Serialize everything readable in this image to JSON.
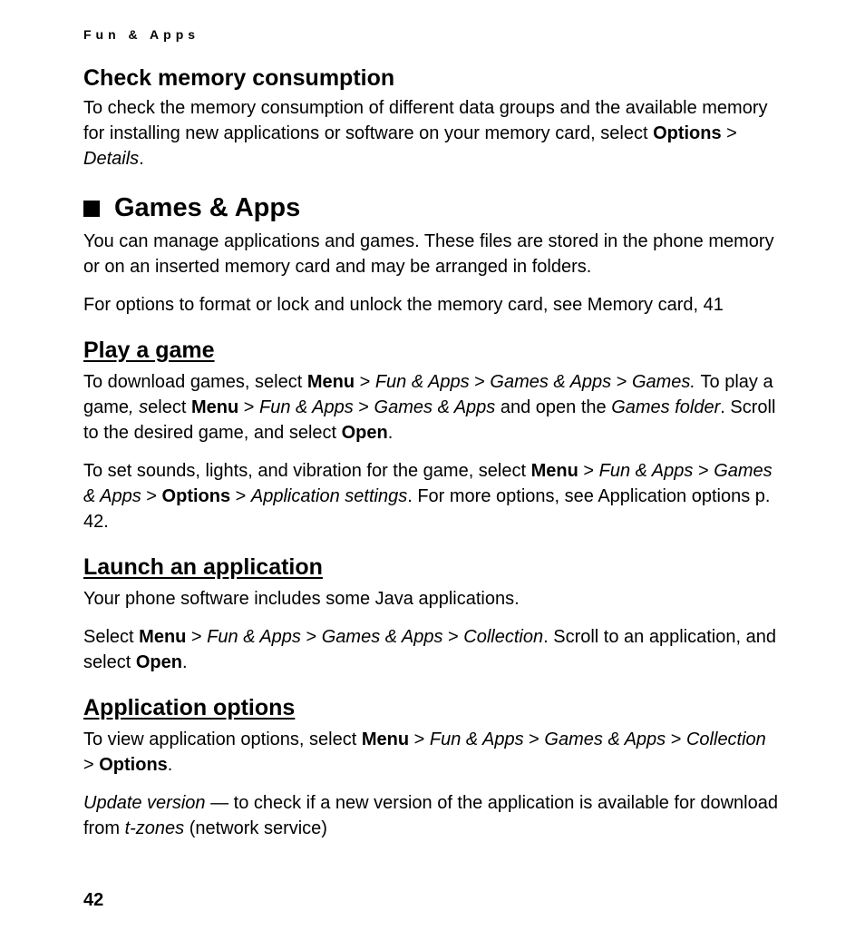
{
  "runningHeader": "Fun & Apps",
  "sections": {
    "checkMemory": {
      "title": "Check memory consumption",
      "p1_a": "To check the memory consumption of different data groups and the available memory for installing new applications or software on your memory card, select ",
      "p1_b": "Options",
      "p1_c": " > ",
      "p1_d": "Details",
      "p1_e": "."
    },
    "gamesApps": {
      "title": "Games & Apps",
      "p1": "You can manage applications and games. These files are stored in the phone memory or on an inserted memory card and may be arranged in folders.",
      "p2": "For options to format or lock and unlock the memory card, see Memory card, 41"
    },
    "playGame": {
      "title": "Play a game",
      "p1_a": "To download games, select ",
      "p1_b": "Menu",
      "p1_c": " > ",
      "p1_d": "Fun & Apps",
      "p1_e": " > ",
      "p1_f": "Games & Apps",
      "p1_g": " > ",
      "p1_h": "Games. ",
      "p1_i": "To play a game",
      "p1_j": ", s",
      "p1_k": "elect ",
      "p1_l": "Menu",
      "p1_m": " > ",
      "p1_n": "Fun & Apps",
      "p1_o": " > ",
      "p1_p": "Games & Apps",
      "p1_q": " and open the ",
      "p1_r": "Games folder",
      "p1_s": ". Scroll to the desired game, and select ",
      "p1_t": "Open",
      "p1_u": ".",
      "p2_a": "To set sounds, lights, and vibration for the game, select ",
      "p2_b": "Menu",
      "p2_c": " > ",
      "p2_d": "Fun & Apps",
      "p2_e": " > ",
      "p2_f": "Games & Apps",
      "p2_g": " > ",
      "p2_h": "Options",
      "p2_i": " > ",
      "p2_j": "Application settings",
      "p2_k": ". For more options, see Application options p. 42."
    },
    "launchApp": {
      "title": "Launch an application",
      "p1": "Your phone software includes some Java applications.",
      "p2_a": "Select ",
      "p2_b": "Menu",
      "p2_c": " > ",
      "p2_d": "Fun & Apps",
      "p2_e": " > ",
      "p2_f": "Games & Apps",
      "p2_g": " > ",
      "p2_h": "Collection",
      "p2_i": ". Scroll to an application, and select ",
      "p2_j": "Open",
      "p2_k": "."
    },
    "appOptions": {
      "title": "Application options",
      "p1_a": "To view application options, select ",
      "p1_b": "Menu",
      "p1_c": " > ",
      "p1_d": "Fun & Apps",
      "p1_e": " > ",
      "p1_f": "Games & Apps",
      "p1_g": " > ",
      "p1_h": "Collection",
      "p1_i": " > ",
      "p1_j": "Options",
      "p1_k": ".",
      "p2_a": "Update version",
      "p2_b": " — to check if a new version of the application is available for download from ",
      "p2_c": "t-zones",
      "p2_d": " (network service)"
    }
  },
  "pageNumber": "42"
}
